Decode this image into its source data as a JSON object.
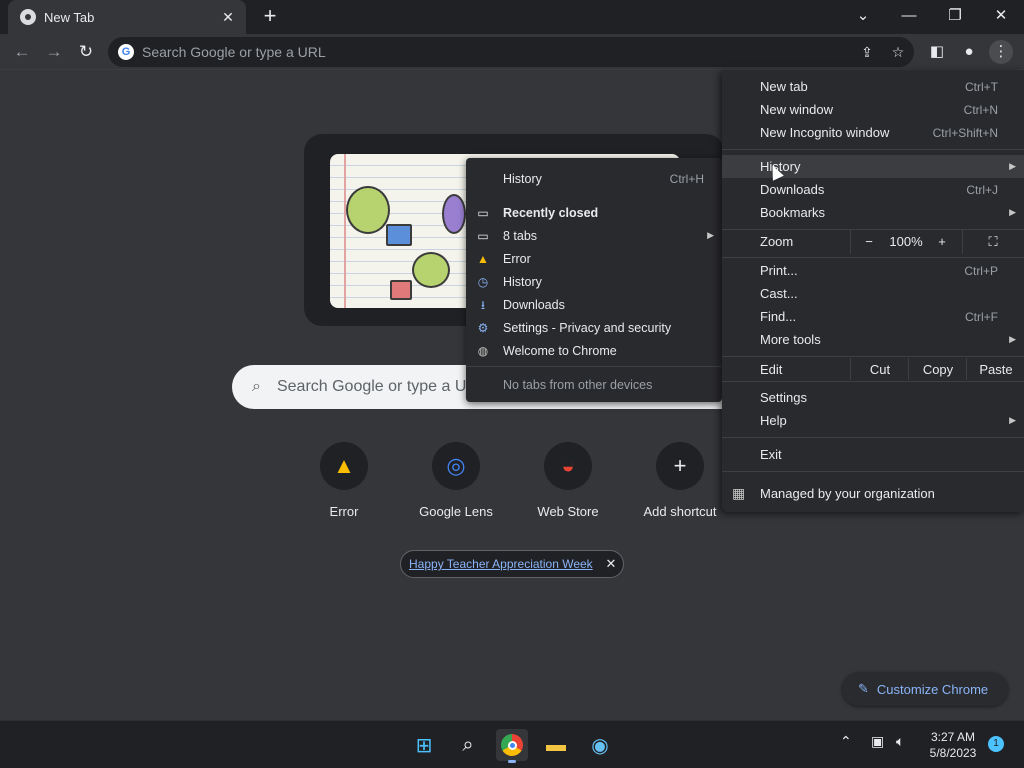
{
  "tab": {
    "title": "New Tab",
    "close": "✕",
    "new_tab": "+"
  },
  "window": {
    "dropdown": "⌄",
    "minimize": "—",
    "restore": "❐",
    "close": "✕"
  },
  "omnibox": {
    "placeholder": "Search Google or type a URL"
  },
  "ntp": {
    "search_placeholder": "Search Google or type a URL",
    "shortcuts": [
      {
        "label": "Error"
      },
      {
        "label": "Google Lens"
      },
      {
        "label": "Web Store"
      },
      {
        "label": "Add shortcut"
      }
    ],
    "promo_link": "Happy Teacher Appreciation Week",
    "customize_label": "Customize Chrome"
  },
  "main_menu": {
    "new_tab": {
      "label": "New tab",
      "shortcut": "Ctrl+T"
    },
    "new_window": {
      "label": "New window",
      "shortcut": "Ctrl+N"
    },
    "new_incognito": {
      "label": "New Incognito window",
      "shortcut": "Ctrl+Shift+N"
    },
    "history": {
      "label": "History"
    },
    "downloads": {
      "label": "Downloads",
      "shortcut": "Ctrl+J"
    },
    "bookmarks": {
      "label": "Bookmarks"
    },
    "zoom": {
      "label": "Zoom",
      "minus": "−",
      "level": "100%",
      "plus": "+"
    },
    "print": {
      "label": "Print...",
      "shortcut": "Ctrl+P"
    },
    "cast": {
      "label": "Cast..."
    },
    "find": {
      "label": "Find...",
      "shortcut": "Ctrl+F"
    },
    "more_tools": {
      "label": "More tools"
    },
    "edit": {
      "label": "Edit",
      "cut": "Cut",
      "copy": "Copy",
      "paste": "Paste"
    },
    "settings": {
      "label": "Settings"
    },
    "help": {
      "label": "Help"
    },
    "exit": {
      "label": "Exit"
    },
    "managed": {
      "label": "Managed by your organization"
    }
  },
  "history_menu": {
    "history": {
      "label": "History",
      "shortcut": "Ctrl+H"
    },
    "recently_closed": "Recently closed",
    "items": [
      {
        "label": "8 tabs",
        "icon": "tabs-icon"
      },
      {
        "label": "Error",
        "icon": "drive-icon"
      },
      {
        "label": "History",
        "icon": "history-icon"
      },
      {
        "label": "Downloads",
        "icon": "download-icon"
      },
      {
        "label": "Settings - Privacy and security",
        "icon": "settings-icon"
      },
      {
        "label": "Welcome to Chrome",
        "icon": "globe-icon"
      }
    ],
    "no_tabs": "No tabs from other devices"
  },
  "taskbar": {
    "time": "3:27 AM",
    "date": "5/8/2023",
    "notification_count": "1"
  },
  "colors": {
    "accent": "#8ab4f8",
    "menu_bg": "#292a2d",
    "page_bg": "#35363a"
  }
}
